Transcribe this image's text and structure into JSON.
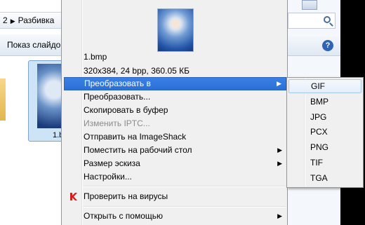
{
  "explorer": {
    "address": {
      "segment_num": "2",
      "segment_name": "Разбивка"
    },
    "toolbar": {
      "slideshow": "Показ слайдов"
    },
    "help": "?",
    "selected_file_label": "1.b"
  },
  "menu": {
    "file_name": "1.bmp",
    "file_info": "320x384, 24 bpp, 360.05 КБ",
    "items": [
      {
        "label": "Преобразовать в",
        "submenu": true
      },
      {
        "label": "Преобразовать..."
      },
      {
        "label": "Скопировать в буфер"
      },
      {
        "label": "Изменить IPTC...",
        "disabled": true
      },
      {
        "label": "Отправить на ImageShack"
      },
      {
        "label": "Поместить на рабочий стол",
        "submenu": true
      },
      {
        "label": "Размер эскиза",
        "submenu": true
      },
      {
        "label": "Настройки..."
      }
    ],
    "antivirus": "Проверить на вирусы",
    "open_with": "Открыть с помощью"
  },
  "submenu": {
    "items": [
      "GIF",
      "BMP",
      "JPG",
      "PCX",
      "PNG",
      "TIF",
      "TGA"
    ]
  },
  "colors": {
    "highlight": "#2a6fd6",
    "menu_bg": "#f0f0f0",
    "antivirus_red": "#d41f1f"
  }
}
